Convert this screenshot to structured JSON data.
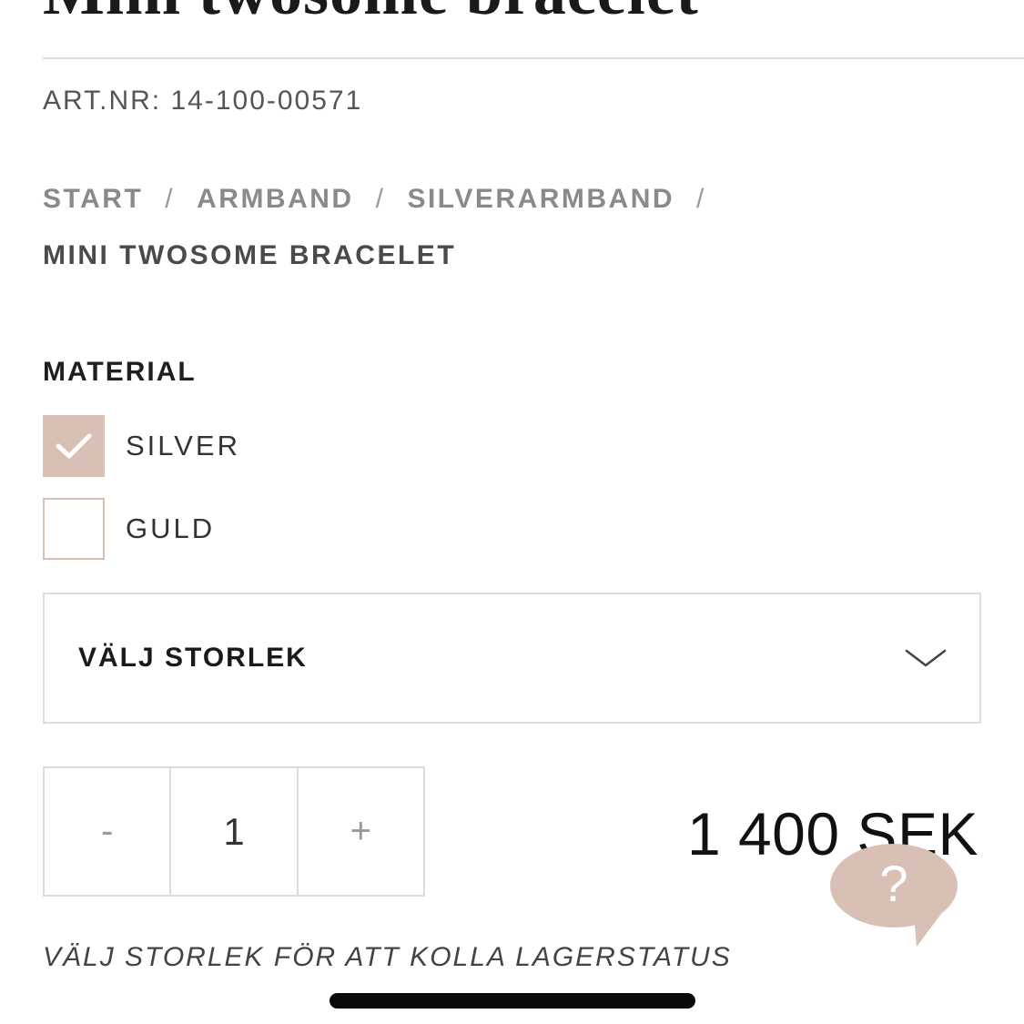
{
  "product": {
    "title": "Mini twosome bracelet",
    "art_nr": "ART.NR: 14-100-00571"
  },
  "breadcrumb": {
    "items": [
      "START",
      "ARMBAND",
      "SILVERARMBAND"
    ],
    "separator": "/",
    "current": "MINI TWOSOME BRACELET"
  },
  "material": {
    "heading": "MATERIAL",
    "options": [
      {
        "label": "SILVER",
        "checked": true
      },
      {
        "label": "GULD",
        "checked": false
      }
    ]
  },
  "size_select": {
    "value": "VÄLJ STORLEK",
    "icon": "chevron-down-icon"
  },
  "quantity": {
    "minus": "-",
    "value": "1",
    "plus": "+"
  },
  "price": "1 400 SEK",
  "help_button": {
    "label": "?",
    "icon": "speech-bubble-icon"
  },
  "stock_note": "VÄLJ STORLEK FÖR ATT KOLLA LAGERSTATUS",
  "colors": {
    "accent": "#d9c0b5",
    "text": "#333333",
    "border": "#dcdcdc"
  }
}
